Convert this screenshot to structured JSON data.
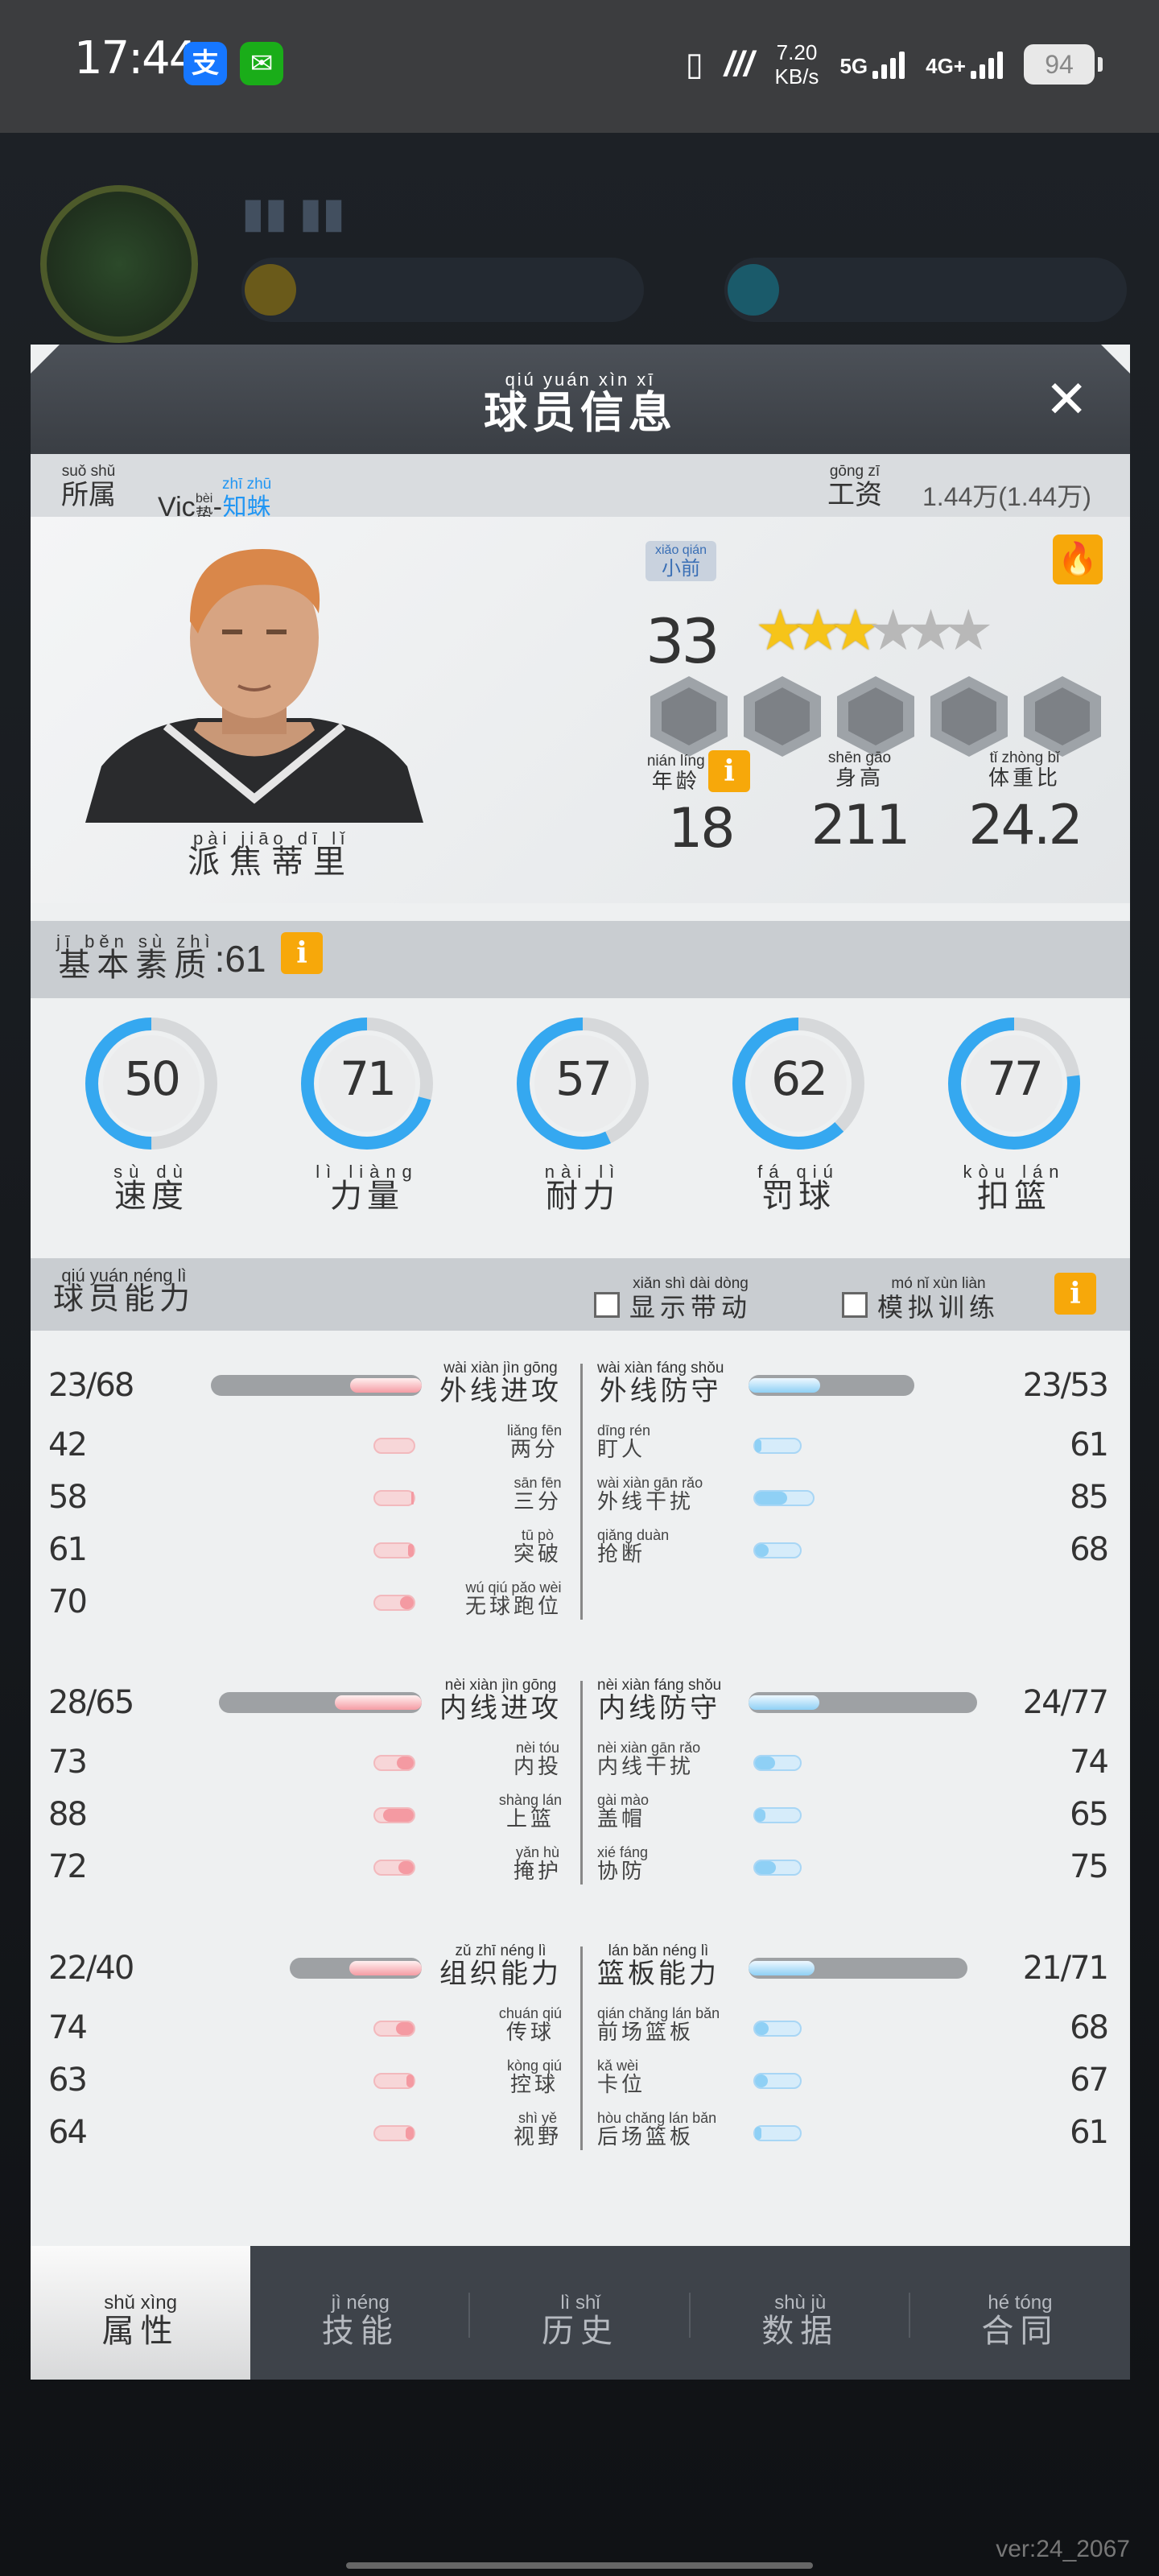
{
  "status_bar": {
    "time": "17:44",
    "net_speed": "7.20",
    "net_unit": "KB/s",
    "net_5g": "5G",
    "net_4g": "4G+",
    "battery": "94"
  },
  "modal": {
    "title_pinyin": "qiú yuán xìn xī",
    "title": "球员信息",
    "close_icon": "close-icon"
  },
  "info_bar": {
    "team_label_py": "suǒ shǔ",
    "team_label": "所属",
    "team_prefix": "Vic",
    "team_hl_py": "zhī zhū",
    "team_hl": "知蛛",
    "team_prefix_py": "bèi",
    "salary_label_py": "gōng zī",
    "salary_label": "工资",
    "salary_value": "1.44万(1.44万)"
  },
  "player": {
    "name_py": "pài jiāo dī lǐ",
    "name": "派焦蒂里",
    "tag_py": "xiǎo qián",
    "tag": "小前",
    "overall": "33",
    "stars_on": 3,
    "stars_total": 6,
    "age_py": "nián líng",
    "age_label": "年龄",
    "age": "18",
    "height_py": "shēn gāo",
    "height_label": "身高",
    "height": "211",
    "bmi_py": "tǐ zhòng bǐ",
    "bmi_label": "体重比",
    "bmi": "24.2"
  },
  "basic": {
    "label_py": "jī běn sù zhì",
    "label": "基本素质",
    "value": ":61",
    "rings": [
      {
        "py": "sù dù",
        "label": "速度",
        "value": "50"
      },
      {
        "py": "lì liàng",
        "label": "力量",
        "value": "71"
      },
      {
        "py": "nài lì",
        "label": "耐力",
        "value": "57"
      },
      {
        "py": "fá qiú",
        "label": "罚球",
        "value": "62"
      },
      {
        "py": "kòu lán",
        "label": "扣篮",
        "value": "77"
      }
    ]
  },
  "ability": {
    "label_py": "qiú yuán néng lì",
    "label": "球员能力",
    "chk1_py": "xiǎn shì dài dòng",
    "chk1": "显示带动",
    "chk2_py": "mó nǐ xùn liàn",
    "chk2": "模拟训练",
    "groups": [
      {
        "left_total": "23/68",
        "left_py": "wài xiàn jìn gōng",
        "left_label": "外线进攻",
        "left_pct": 0.34,
        "right_total": "23/53",
        "right_py": "wài xiàn fáng shǒu",
        "right_label": "外线防守",
        "right_pct": 0.43,
        "rows": [
          {
            "lv": "42",
            "lpy": "liǎng fēn",
            "ll": "两分",
            "rpy": "dīng rén",
            "rl": "盯人",
            "rv": "61"
          },
          {
            "lv": "58",
            "lpy": "sān fēn",
            "ll": "三分",
            "rpy": "wài xiàn gān rǎo",
            "rl": "外线干扰",
            "rv": "85"
          },
          {
            "lv": "61",
            "lpy": "tū pò",
            "ll": "突破",
            "rpy": "qiǎng duàn",
            "rl": "抢断",
            "rv": "68"
          },
          {
            "lv": "70",
            "lpy": "wú qiú pǎo wèi",
            "ll": "无球跑位",
            "rpy": "",
            "rl": "",
            "rv": ""
          }
        ]
      },
      {
        "left_total": "28/65",
        "left_py": "nèi xiàn jìn gōng",
        "left_label": "内线进攻",
        "left_pct": 0.43,
        "right_total": "24/77",
        "right_py": "nèi xiàn fáng shǒu",
        "right_label": "内线防守",
        "right_pct": 0.31,
        "rows": [
          {
            "lv": "73",
            "lpy": "nèi tóu",
            "ll": "内投",
            "rpy": "nèi xiàn gān rǎo",
            "rl": "内线干扰",
            "rv": "74"
          },
          {
            "lv": "88",
            "lpy": "shàng lán",
            "ll": "上篮",
            "rpy": "gài mào",
            "rl": "盖帽",
            "rv": "65"
          },
          {
            "lv": "72",
            "lpy": "yǎn hù",
            "ll": "掩护",
            "rpy": "xié fáng",
            "rl": "协防",
            "rv": "75"
          }
        ]
      },
      {
        "left_total": "22/40",
        "left_py": "zǔ zhī néng lì",
        "left_label": "组织能力",
        "left_pct": 0.55,
        "right_total": "21/71",
        "right_py": "lán bǎn néng lì",
        "right_label": "篮板能力",
        "right_pct": 0.3,
        "rows": [
          {
            "lv": "74",
            "lpy": "chuán qiú",
            "ll": "传球",
            "rpy": "qián chǎng lán bǎn",
            "rl": "前场篮板",
            "rv": "68"
          },
          {
            "lv": "63",
            "lpy": "kòng qiú",
            "ll": "控球",
            "rpy": "kǎ wèi",
            "rl": "卡位",
            "rv": "67"
          },
          {
            "lv": "64",
            "lpy": "shì yě",
            "ll": "视野",
            "rpy": "hòu chǎng lán bǎn",
            "rl": "后场篮板",
            "rv": "61"
          }
        ]
      }
    ]
  },
  "tabs": [
    {
      "py": "shǔ xìng",
      "label": "属性"
    },
    {
      "py": "jì néng",
      "label": "技能"
    },
    {
      "py": "lì shǐ",
      "label": "历史"
    },
    {
      "py": "shù jù",
      "label": "数据"
    },
    {
      "py": "hé tóng",
      "label": "合同"
    }
  ],
  "version": "ver:24_2067",
  "colors": {
    "accent": "#2196f3",
    "info": "#f7a80a",
    "ring": "#35a8f0"
  }
}
